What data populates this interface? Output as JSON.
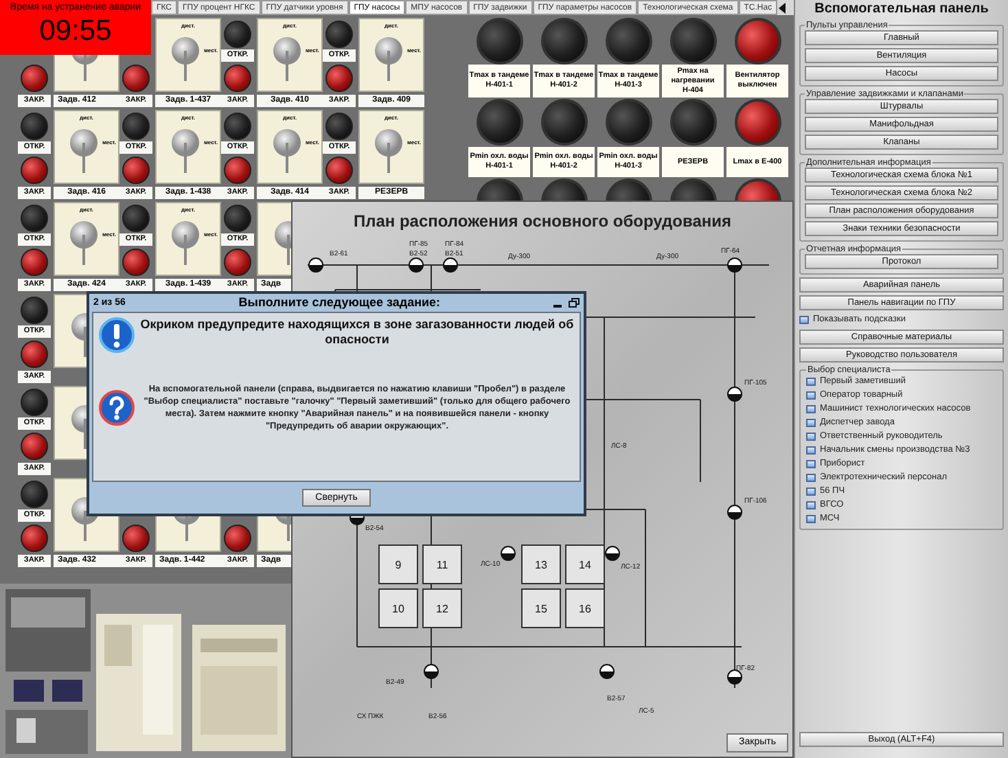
{
  "timer": {
    "caption": "Время на устранение аварии",
    "time": "09:55"
  },
  "tabs": [
    {
      "label": "ГКС",
      "selected": false
    },
    {
      "label": "ГПУ процент НГКС",
      "selected": false
    },
    {
      "label": "ГПУ датчики уровня",
      "selected": false
    },
    {
      "label": "ГПУ насосы",
      "selected": true
    },
    {
      "label": "МПУ насосов",
      "selected": false
    },
    {
      "label": "ГПУ задвижки",
      "selected": false
    },
    {
      "label": "ГПУ параметры насосов",
      "selected": false
    },
    {
      "label": "Технологическая схема",
      "selected": false
    },
    {
      "label": "ТС.Нас",
      "selected": false
    }
  ],
  "valve_rows": [
    {
      "cells": [
        {
          "closed": true,
          "close_label": "ЗАКР.",
          "name": "Задв. 412"
        },
        {
          "closed": true,
          "close_label": "ЗАКР.",
          "top": "дист.",
          "side": "мест.",
          "name": "Задв. 1-437"
        },
        {
          "closed": true,
          "open_label": "ОТКР.",
          "close_label": "ЗАКР.",
          "top": "дист.",
          "side": "мест.",
          "name": "Задв. 410"
        },
        {
          "closed": true,
          "open_label": "ОТКР.",
          "close_label": "ЗАКР.",
          "top": "дист.",
          "side": "мест.",
          "name": "Задв. 409"
        }
      ]
    },
    {
      "cells": [
        {
          "closed": true,
          "open_label": "ОТКР.",
          "close_label": "ЗАКР.",
          "top": "дист.",
          "side": "мест.",
          "name": "Задв. 416"
        },
        {
          "closed": true,
          "open_label": "ОТКР.",
          "close_label": "ЗАКР.",
          "top": "дист.",
          "side": "мест.",
          "name": "Задв. 1-438"
        },
        {
          "closed": true,
          "open_label": "ОТКР.",
          "close_label": "ЗАКР.",
          "top": "дист.",
          "side": "мест.",
          "name": "Задв. 414"
        },
        {
          "closed": true,
          "open_label": "ОТКР.",
          "close_label": "ЗАКР.",
          "top": "дист.",
          "side": "мест.",
          "name": "РЕЗЕРВ"
        }
      ]
    },
    {
      "cells": [
        {
          "closed": true,
          "open_label": "ОТКР.",
          "close_label": "ЗАКР.",
          "top": "дист.",
          "side": "мест.",
          "name": "Задв. 424"
        },
        {
          "closed": true,
          "open_label": "ОТКР.",
          "close_label": "ЗАКР.",
          "top": "дист.",
          "side": "мест.",
          "name": "Задв. 1-439"
        },
        {
          "closed": true,
          "open_label": "ОТКР.",
          "close_label": "ЗАКР.",
          "name": "Задв"
        }
      ]
    },
    {
      "cells": [
        {
          "closed": true,
          "open_label": "ОТКР.",
          "close_label": "ЗАКР."
        }
      ]
    },
    {
      "cells": [
        {
          "closed": true,
          "open_label": "ОТКР.",
          "close_label": "ЗАКР."
        }
      ]
    },
    {
      "cells": [
        {
          "closed": true,
          "open_label": "ОТКР.",
          "close_label": "ЗАКР.",
          "name": "Задв. 432"
        },
        {
          "closed": true,
          "close_label": "ЗАКР.",
          "name": "Задв. 1-442"
        },
        {
          "closed": true,
          "close_label": "ЗАКР.",
          "name": "Задв"
        }
      ]
    }
  ],
  "indicator_rows": [
    {
      "items": [
        {
          "label": "Tmax в тандеме Н-401-1",
          "lit": false
        },
        {
          "label": "Tmax в тандеме Н-401-2",
          "lit": false
        },
        {
          "label": "Tmax в тандеме Н-401-3",
          "lit": false
        },
        {
          "label": "Pmax на нагревании Н-404",
          "lit": false
        },
        {
          "label": "Вентилятор выключен",
          "lit": true
        }
      ]
    },
    {
      "items": [
        {
          "label": "Pmin охл. воды Н-401-1",
          "lit": false
        },
        {
          "label": "Pmin охл. воды Н-401-2",
          "lit": false
        },
        {
          "label": "Pmin охл. воды Н-401-3",
          "lit": false
        },
        {
          "label": "РЕЗЕРВ",
          "lit": false
        },
        {
          "label": "Lmax в Е-400",
          "lit": true
        }
      ]
    },
    {
      "items": [
        {
          "lit": false
        },
        {
          "lit": false
        },
        {
          "lit": false
        },
        {
          "lit": false
        },
        {
          "lit": true
        }
      ]
    }
  ],
  "plan_window": {
    "title": "План расположения основного оборудования",
    "labels": [
      "В2-61",
      "ПГ-85",
      "В2-52",
      "Ду-300",
      "ПГ-84",
      "В2-51",
      "Ду-300",
      "ПГ-64",
      "ПГ-105",
      "ЛС-8",
      "В2-54",
      "ЛС-10",
      "ЛС-12",
      "ПГ-106",
      "В2-49",
      "В2-56",
      "СХ ПЖК",
      "В2-57",
      "ЛС-5",
      "ПГ-82"
    ],
    "tanks": [
      "9",
      "11",
      "13",
      "14",
      "10",
      "12",
      "15",
      "16"
    ],
    "close_button": "Закрыть"
  },
  "dialog": {
    "counter": "2 из 56",
    "title": "Выполните следующее задание:",
    "message": "Окриком предупредите находящихся в зоне загазованности людей об опасности",
    "instruction": "На вспомогательной панели (справа, выдвигается по нажатию клавиши \"Пробел\") в разделе \"Выбор специалиста\" поставьте \"галочку\" \"Первый заметивший\" (только для общего рабочего места). Затем нажмите кнопку \"Аварийная панель\" и на появившейся панели - кнопку \"Предупредить об аварии окружающих\".",
    "button": "Свернуть"
  },
  "side_panel": {
    "title": "Вспомогательная панель",
    "sections": [
      {
        "kind": "group",
        "legend": "Пульты управления",
        "buttons": [
          "Главный",
          "Вентиляция",
          "Насосы"
        ]
      },
      {
        "kind": "group",
        "legend": "Управление задвижками и клапанами",
        "buttons": [
          "Штурвалы",
          "Манифольдная",
          "Клапаны"
        ]
      },
      {
        "kind": "group",
        "legend": "Дополнительная информация",
        "buttons": [
          "Технологическая схема блока №1",
          "Технологическая схема блока №2",
          "План расположения оборудования",
          "Знаки техники безопасности"
        ]
      },
      {
        "kind": "group",
        "legend": "Отчетная информация",
        "buttons": [
          "Протокол"
        ]
      },
      {
        "kind": "button",
        "label": "Аварийная панель"
      },
      {
        "kind": "button",
        "label": "Панель навигации по ГПУ"
      },
      {
        "kind": "checkbox",
        "label": "Показывать подсказки",
        "checked": false
      },
      {
        "kind": "button",
        "label": "Справочные материалы"
      },
      {
        "kind": "button",
        "label": "Руководство пользователя"
      },
      {
        "kind": "checklist",
        "legend": "Выбор специалиста",
        "items": [
          {
            "label": "Первый заметивший",
            "checked": false
          },
          {
            "label": "Оператор товарный",
            "checked": false
          },
          {
            "label": "Машинист технологических насосов",
            "checked": false
          },
          {
            "label": "Диспетчер завода",
            "checked": false
          },
          {
            "label": "Ответственный руководитель",
            "checked": false
          },
          {
            "label": "Начальник смены производства №3",
            "checked": false
          },
          {
            "label": "Приборист",
            "checked": false
          },
          {
            "label": "Электротехнический персонал",
            "checked": false
          },
          {
            "label": "56 ПЧ",
            "checked": false
          },
          {
            "label": "ВГСО",
            "checked": false
          },
          {
            "label": "МСЧ",
            "checked": false
          }
        ]
      }
    ],
    "exit_button": "Выход (ALT+F4)"
  }
}
